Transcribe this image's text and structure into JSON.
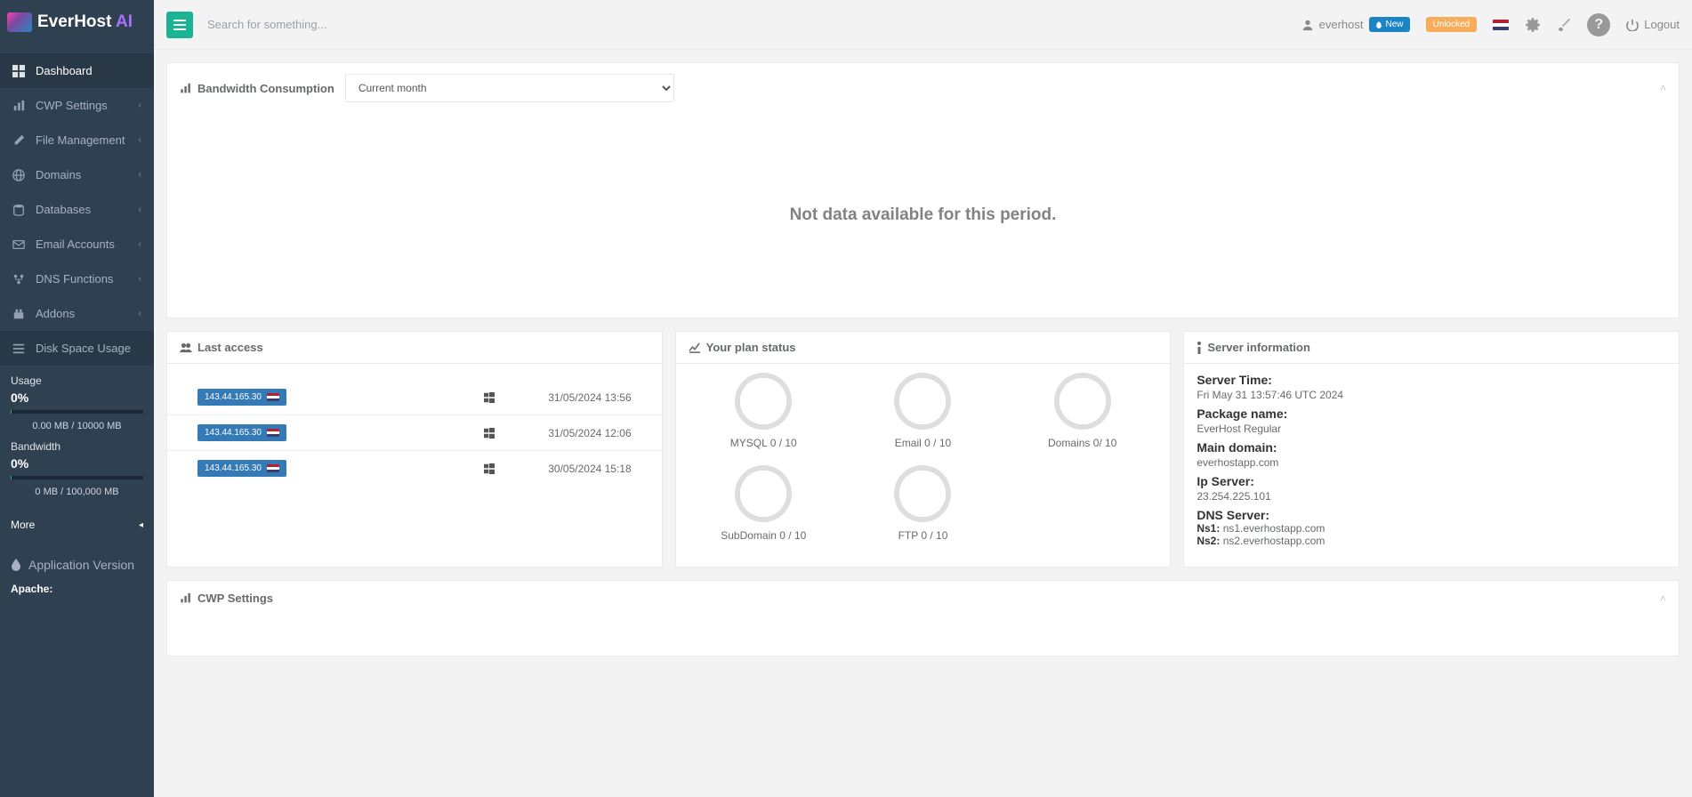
{
  "brand": {
    "name_a": "EverHost",
    "name_b": " AI"
  },
  "search": {
    "placeholder": "Search for something..."
  },
  "topbar": {
    "username": "everhost",
    "new_badge": "New",
    "unlocked_badge": "Unlocked",
    "logout": "Logout"
  },
  "nav": {
    "dashboard": "Dashboard",
    "cwp_settings": "CWP Settings",
    "file_management": "File Management",
    "domains": "Domains",
    "databases": "Databases",
    "email_accounts": "Email Accounts",
    "dns_functions": "DNS Functions",
    "addons": "Addons",
    "disk_space_usage": "Disk Space Usage"
  },
  "widgets": {
    "usage_label": "Usage",
    "usage_pct": "0%",
    "usage_detail": "0.00 MB / 10000 MB",
    "bandwidth_label": "Bandwidth",
    "bandwidth_pct": "0%",
    "bandwidth_detail": "0 MB / 100,000 MB",
    "more": "More"
  },
  "sidebar_footer": {
    "section_title": "Application Version",
    "apache_label": "Apache:"
  },
  "bandwidth_panel": {
    "title": "Bandwidth Consumption",
    "selected_period": "Current month",
    "empty_message": "Not data available for this period."
  },
  "last_access": {
    "title": "Last access",
    "rows": [
      {
        "ip": "143.44.165.30",
        "date": "31/05/2024 13:56"
      },
      {
        "ip": "143.44.165.30",
        "date": "31/05/2024 12:06"
      },
      {
        "ip": "143.44.165.30",
        "date": "30/05/2024 15:18"
      }
    ]
  },
  "plan_status": {
    "title": "Your plan status",
    "items": [
      {
        "label": "MYSQL 0 / 10"
      },
      {
        "label": "Email 0 / 10"
      },
      {
        "label": "Domains 0/ 10"
      },
      {
        "label": "SubDomain 0 / 10"
      },
      {
        "label": "FTP 0 / 10"
      }
    ]
  },
  "server_info": {
    "title": "Server information",
    "server_time_label": "Server Time:",
    "server_time_value": "Fri May 31 13:57:46 UTC 2024",
    "package_label": "Package name:",
    "package_value": "EverHost Regular",
    "domain_label": "Main domain:",
    "domain_value": "everhostapp.com",
    "ip_label": "Ip Server:",
    "ip_value": "23.254.225.101",
    "dns_label": "DNS Server:",
    "ns1_label": "Ns1:",
    "ns1_value": "ns1.everhostapp.com",
    "ns2_label": "Ns2:",
    "ns2_value": "ns2.everhostapp.com"
  },
  "cwp_panel": {
    "title": "CWP Settings"
  }
}
